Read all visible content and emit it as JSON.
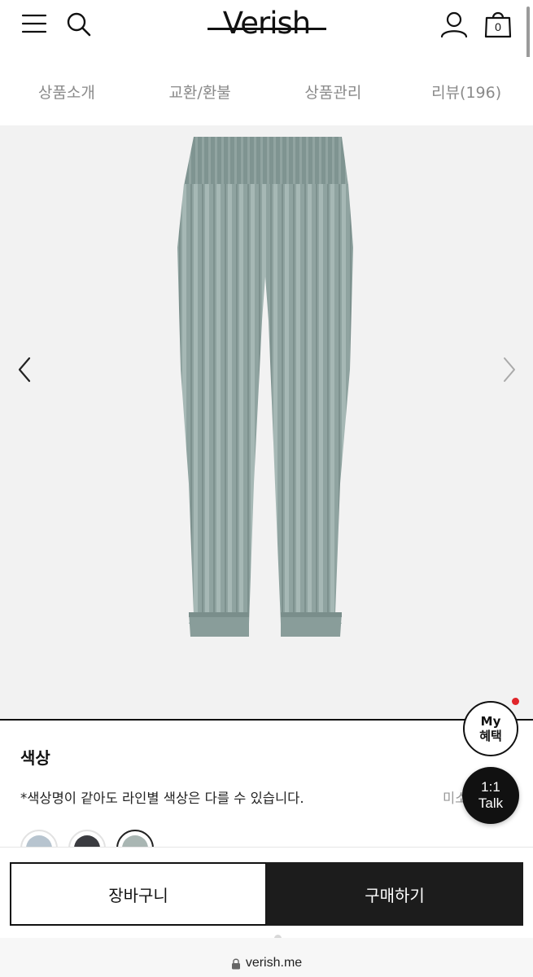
{
  "header": {
    "brand": "Verish",
    "cart_count": "0",
    "icons": [
      "menu-icon",
      "search-icon",
      "user-icon",
      "shopping-bag-icon"
    ]
  },
  "tabs": [
    {
      "label": "상품소개"
    },
    {
      "label": "교환/환불"
    },
    {
      "label": "상품관리"
    },
    {
      "label": "리뷰(196)"
    }
  ],
  "gallery": {
    "product_color": "#8fa3a0",
    "prev_icon": "chevron-left-icon",
    "next_icon": "chevron-right-icon"
  },
  "options": {
    "title": "색상",
    "note": "*색상명이 같아도 라인별 색상은 다를 수 있습니다.",
    "more": "미소",
    "swatches": [
      {
        "color": "#b7c4cf",
        "selected": false
      },
      {
        "color": "#3a3b40",
        "selected": false
      },
      {
        "color": "#a9b6b3",
        "selected": true
      }
    ]
  },
  "floating": {
    "my_line1": "My",
    "my_line2": "혜택",
    "talk_line1": "1:1",
    "talk_line2": "Talk"
  },
  "actions": {
    "cart_label": "장바구니",
    "buy_label": "구매하기"
  },
  "browser": {
    "url": "verish.me"
  },
  "colors": {
    "accent_dark": "#1c1c1c",
    "notification_red": "#e0262b",
    "tab_text": "#8a8a8a"
  }
}
